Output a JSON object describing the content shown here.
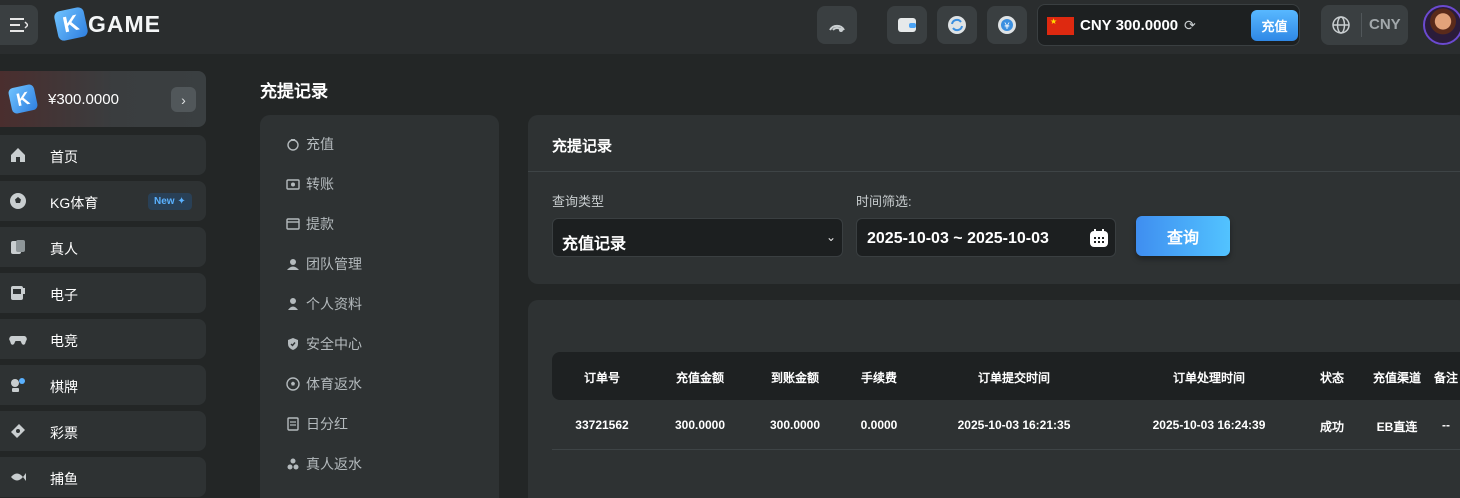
{
  "header": {
    "logo_letter": "K",
    "logo_text": "GAME",
    "balance": "CNY 300.0000",
    "deposit_label": "充值",
    "currency": "CNY",
    "icons": [
      "speedometer-icon",
      "wallet-icon",
      "swap-icon",
      "yen-icon",
      "globe-icon"
    ]
  },
  "sidebar": {
    "wallet_amount": "¥300.0000",
    "items": [
      {
        "label": "首页",
        "icon": "home-icon"
      },
      {
        "label": "KG体育",
        "icon": "soccer-ball-icon",
        "badge": "New ✦"
      },
      {
        "label": "真人",
        "icon": "cards-icon"
      },
      {
        "label": "电子",
        "icon": "slot-machine-icon"
      },
      {
        "label": "电竞",
        "icon": "gamepad-icon"
      },
      {
        "label": "棋牌",
        "icon": "chess-icon"
      },
      {
        "label": "彩票",
        "icon": "lottery-ticket-icon"
      },
      {
        "label": "捕鱼",
        "icon": "fish-icon"
      }
    ]
  },
  "page_title": "充提记录",
  "subnav": {
    "items": [
      {
        "label": "充值",
        "icon": "piggy-bank-icon"
      },
      {
        "label": "转账",
        "icon": "transfer-icon"
      },
      {
        "label": "提款",
        "icon": "withdraw-icon"
      },
      {
        "label": "团队管理",
        "icon": "team-icon"
      },
      {
        "label": "个人资料",
        "icon": "user-icon"
      },
      {
        "label": "安全中心",
        "icon": "shield-icon"
      },
      {
        "label": "体育返水",
        "icon": "soccer-icon"
      },
      {
        "label": "日分红",
        "icon": "calendar-icon"
      },
      {
        "label": "真人返水",
        "icon": "chips-icon"
      }
    ]
  },
  "filter": {
    "title": "充提记录",
    "type_label": "查询类型",
    "type_value": "充值记录",
    "date_label": "时间筛选:",
    "date_value": "2025-10-03 ~ 2025-10-03",
    "query_label": "查询"
  },
  "table": {
    "headers": [
      "订单号",
      "充值金额",
      "到账金额",
      "手续费",
      "订单提交时间",
      "订单处理时间",
      "状态",
      "充值渠道",
      "备注"
    ],
    "rows": [
      [
        "33721562",
        "300.0000",
        "300.0000",
        "0.0000",
        "2025-10-03 16:21:35",
        "2025-10-03 16:24:39",
        "成功",
        "EB直连",
        "--"
      ]
    ]
  },
  "colors": {
    "accent": "#3f8ef0",
    "background": "#232626",
    "card": "#2e3233"
  }
}
